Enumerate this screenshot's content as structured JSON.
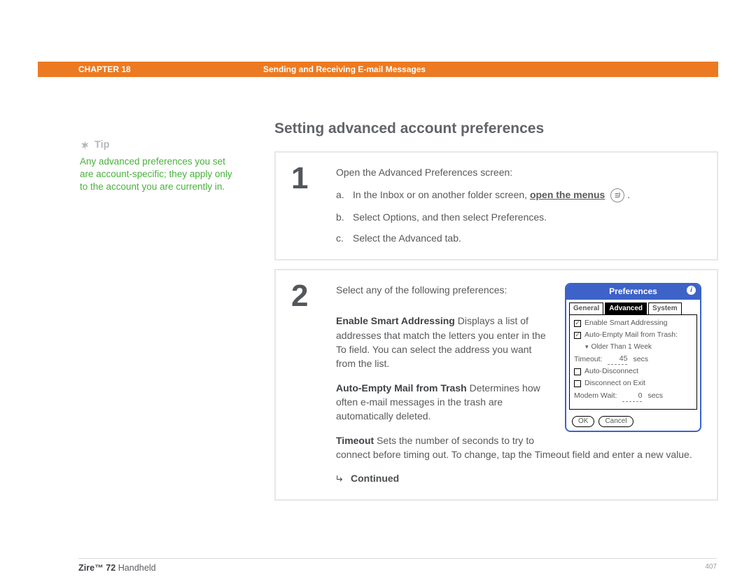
{
  "header": {
    "chapter": "CHAPTER 18",
    "title": "Sending and Receiving E-mail Messages"
  },
  "sidebar": {
    "tip_label": "Tip",
    "tip_body": "Any advanced preferences you set are account-specific; they apply only to the account you are currently in."
  },
  "main": {
    "title": "Setting advanced account preferences",
    "step1": {
      "num": "1",
      "intro": "Open the Advanced Preferences screen:",
      "a_prefix": "In the Inbox or on another folder screen, ",
      "a_link": "open the menus",
      "a_suffix": " ",
      "b": "Select Options, and then select Preferences.",
      "c": "Select the Advanced tab."
    },
    "step2": {
      "num": "2",
      "intro": "Select any of the following preferences:",
      "opt1_name": "Enable Smart Addressing",
      "opt1_body": "   Displays a list of addresses that match the letters you enter in the To field. You can select the address you want from the list.",
      "opt2_name": "Auto-Empty Mail from Trash",
      "opt2_body": "   Determines how often e-mail messages in the trash are automatically deleted.",
      "opt3_name": "Timeout",
      "opt3_body": "   Sets the number of seconds to try to connect before timing out. To change, tap the Timeout field and enter a new value.",
      "continued": "Continued"
    }
  },
  "palm": {
    "title": "Preferences",
    "tabs": [
      "General",
      "Advanced",
      "System"
    ],
    "active_tab": 1,
    "chk1": "Enable Smart Addressing",
    "chk1_on": true,
    "chk2": "Auto-Empty Mail from Trash:",
    "chk2_on": true,
    "dd": "Older Than 1 Week",
    "timeout_label": "Timeout:",
    "timeout_val": "45",
    "timeout_unit": "secs",
    "chk3": "Auto-Disconnect",
    "chk3_on": false,
    "chk4": "Disconnect on Exit",
    "chk4_on": false,
    "modem_label": "Modem Wait:",
    "modem_val": "0",
    "modem_unit": "secs",
    "ok": "OK",
    "cancel": "Cancel"
  },
  "footer": {
    "product_bold": "Zire™ 72",
    "product_rest": " Handheld",
    "page": "407"
  }
}
